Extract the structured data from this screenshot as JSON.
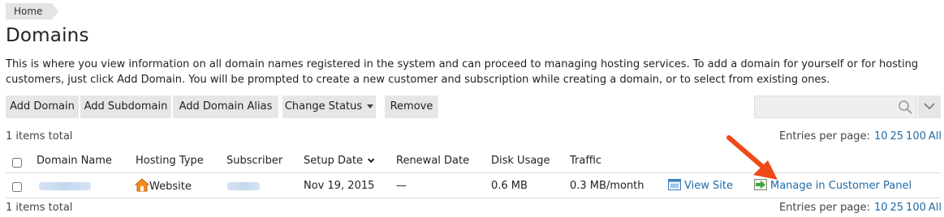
{
  "breadcrumb": {
    "home": "Home"
  },
  "page": {
    "title": "Domains",
    "description": "This is where you view information on all domain names registered in the system and can proceed to managing hosting services. To add a domain for yourself or for hosting customers, just click Add Domain. You will be prompted to create a new customer and subscription while creating a domain, or to select from existing ones."
  },
  "toolbar": {
    "add_domain": "Add Domain",
    "add_subdomain": "Add Subdomain",
    "add_alias": "Add Domain Alias",
    "change_status": "Change Status",
    "remove": "Remove"
  },
  "search": {
    "placeholder": "",
    "value": ""
  },
  "summary": {
    "items_total": "1 items total",
    "entries_label": "Entries per page:",
    "entries_options": [
      "10",
      "25",
      "100",
      "All"
    ]
  },
  "table": {
    "columns": [
      "Domain Name",
      "Hosting Type",
      "Subscriber",
      "Setup Date",
      "Renewal Date",
      "Disk Usage",
      "Traffic"
    ],
    "rows": [
      {
        "hosting_type": "Website",
        "setup_date": "Nov 19, 2015",
        "renewal_date": "—",
        "disk_usage": "0.6 MB",
        "traffic": "0.3 MB/month",
        "view_site": "View Site",
        "manage": "Manage in Customer Panel"
      }
    ]
  },
  "icons": {
    "house": "house-icon",
    "view_site": "browser-window-icon",
    "manage": "green-arrow-panel-icon",
    "search": "magnifier-icon",
    "annotation": "red-arrow"
  },
  "colors": {
    "link": "#1e6ba8",
    "button_bg": "#e6e6e6",
    "annotation_arrow": "#f04a1a"
  }
}
